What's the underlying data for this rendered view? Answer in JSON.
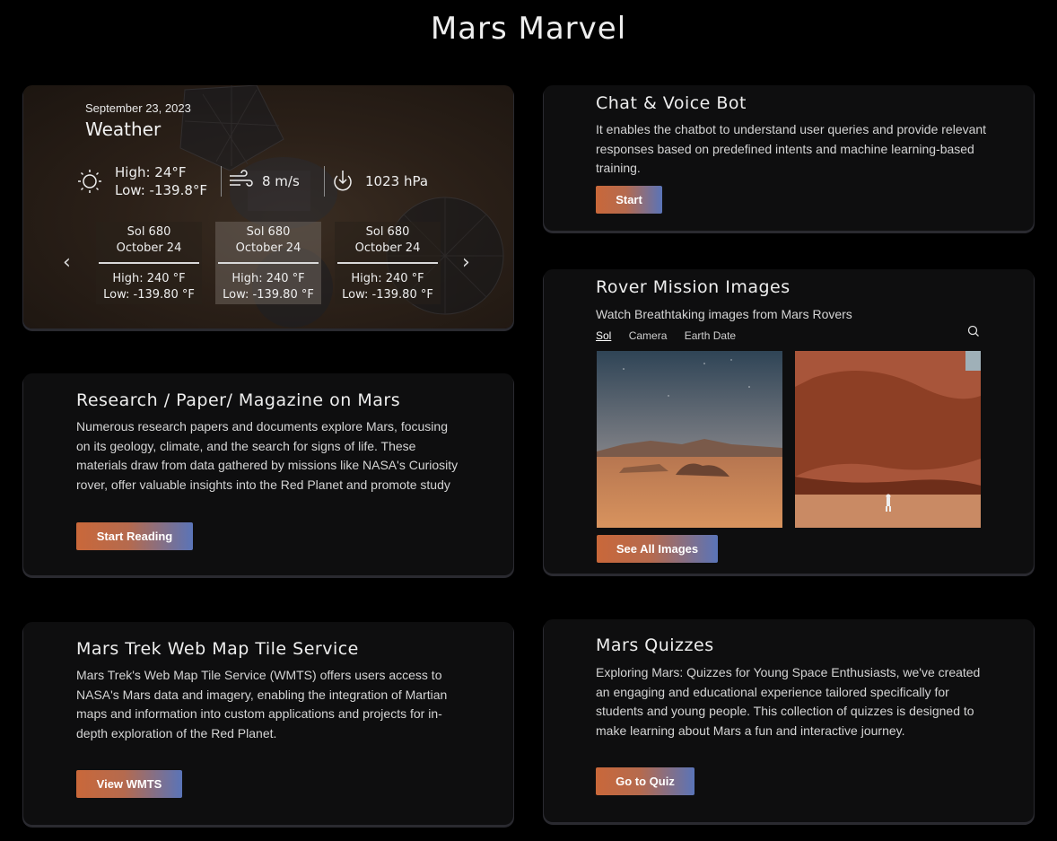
{
  "page": {
    "title": "Mars Marvel"
  },
  "weather": {
    "date": "September 23, 2023",
    "title": "Weather",
    "high": "High: 24°F",
    "low": "Low: -139.8°F",
    "wind": "8  m/s",
    "pressure": "1023  hPa",
    "prev_icon": "chevron-left-icon",
    "next_icon": "chevron-right-icon",
    "forecast": [
      {
        "sol": "Sol 680",
        "date": "October 24",
        "high": "High: 240 °F",
        "low": "Low: -139.80 °F"
      },
      {
        "sol": "Sol 680",
        "date": "October 24",
        "high": "High: 240 °F",
        "low": "Low: -139.80 °F"
      },
      {
        "sol": "Sol 680",
        "date": "October 24",
        "high": "High: 240 °F",
        "low": "Low: -139.80 °F"
      }
    ]
  },
  "chat": {
    "title": "Chat & Voice Bot",
    "text": "It enables the chatbot to understand user queries and provide relevant responses based on predefined intents and machine learning-based training.",
    "button": "Start"
  },
  "rover": {
    "title": "Rover Mission Images",
    "text": "Watch Breathtaking images from Mars Rovers",
    "tabs": [
      "Sol",
      "Camera",
      "Earth Date"
    ],
    "button": "See All Images"
  },
  "research": {
    "title": "Research / Paper/ Magazine on Mars",
    "text": "Numerous research papers and documents explore Mars, focusing on its geology, climate, and the search for signs of life. These materials draw from data gathered by missions like NASA's Curiosity rover, offer valuable insights into the Red Planet and promote study",
    "button": "Start Reading"
  },
  "trek": {
    "title": "Mars Trek Web Map Tile Service",
    "text": "Mars Trek's Web Map Tile Service (WMTS) offers users access to NASA's Mars data and imagery, enabling the integration of Martian maps and information into custom applications and projects for in-depth exploration of the Red Planet.",
    "button": "View WMTS"
  },
  "quiz": {
    "title": "Mars Quizzes",
    "text": "Exploring Mars: Quizzes for Young Space Enthusiasts, we've created an engaging and educational experience tailored specifically for students and young people. This collection of quizzes is designed to make learning about Mars a fun and interactive journey.",
    "button": "Go to Quiz"
  },
  "colors": {
    "accent_start": "#c9683a",
    "accent_end": "#5a74b8",
    "card_bg": "#0e0e0f"
  }
}
